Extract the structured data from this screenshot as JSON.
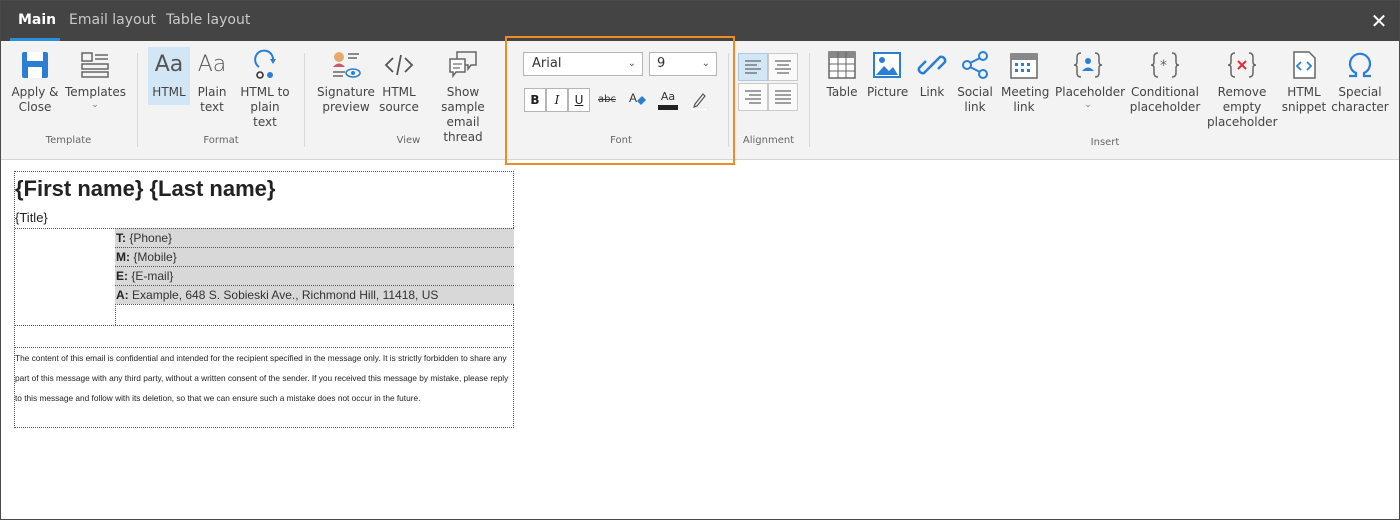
{
  "tabs": [
    {
      "label": "Main",
      "active": true
    },
    {
      "label": "Email layout",
      "active": false
    },
    {
      "label": "Table layout",
      "active": false
    }
  ],
  "close_label": "✕",
  "ribbon": {
    "template": {
      "group_label": "Template",
      "apply_close": "Apply & Close",
      "templates": "Templates"
    },
    "format": {
      "group_label": "Format",
      "html": "HTML",
      "plain_text": "Plain text",
      "html_to_plain": "HTML to plain text"
    },
    "view": {
      "group_label": "View",
      "signature_preview": "Signature preview",
      "html_source": "HTML source",
      "show_sample": "Show sample email thread"
    },
    "font": {
      "group_label": "Font",
      "font_name": "Arial",
      "font_size": "9",
      "bold": "B",
      "italic": "I",
      "underline": "U",
      "strike": "abc",
      "font_color": "Aa"
    },
    "alignment": {
      "group_label": "Alignment"
    },
    "insert": {
      "group_label": "Insert",
      "table": "Table",
      "picture": "Picture",
      "link": "Link",
      "social_link": "Social link",
      "meeting_link": "Meeting link",
      "placeholder": "Placeholder",
      "conditional_placeholder": "Conditional placeholder",
      "remove_empty_placeholder": "Remove empty placeholder",
      "html_snippet": "HTML snippet",
      "special_character": "Special character"
    }
  },
  "signature": {
    "name": "{First name} {Last name}",
    "title": "{Title}",
    "contacts": [
      {
        "key": "T:",
        "value": "{Phone}"
      },
      {
        "key": "M:",
        "value": "{Mobile}"
      },
      {
        "key": "E:",
        "value": "{E-mail}"
      },
      {
        "key": "A:",
        "value": "Example, 648 S. Sobieski Ave., Richmond Hill, 11418, US"
      }
    ],
    "disclaimer": "The content of this email is confidential and intended for the recipient specified in the message only. It is strictly forbidden to share any part of this message with any third party, without a written consent of the sender. If you received this message by mistake, please reply to this message and follow with its deletion, so that we can ensure such a mistake does not occur in the future."
  },
  "colors": {
    "accent": "#2b8fd6",
    "highlight_outline": "#f08a24",
    "tabbar_bg": "#444444"
  }
}
